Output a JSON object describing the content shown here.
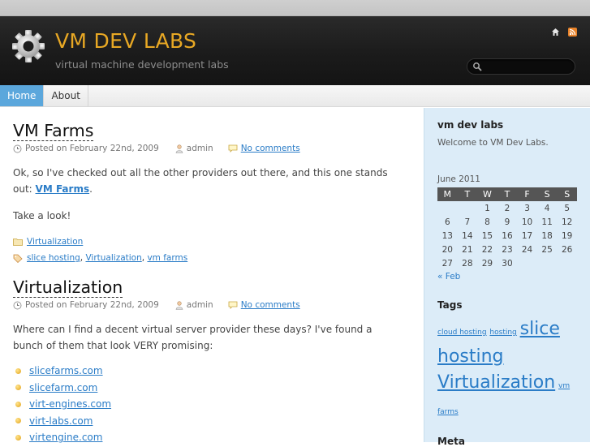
{
  "site": {
    "title": "VM DEV LABS",
    "tagline": "virtual machine development labs",
    "search_placeholder": "",
    "icons": [
      "home-icon",
      "rss-icon"
    ]
  },
  "nav": {
    "items": [
      {
        "label": "Home",
        "active": true
      },
      {
        "label": "About",
        "active": false
      }
    ]
  },
  "posts": [
    {
      "title": "VM Farms",
      "date": "Posted on February 22nd, 2009",
      "author": "admin",
      "comments": "No comments",
      "body_text": "Ok, so I've checked out all the other providers out there, and this one stands out:",
      "body_link": "VM Farms",
      "body_after": ".",
      "body2": "Take a look!",
      "category": "Virtualization",
      "tags": [
        "slice hosting",
        "Virtualization",
        "vm farms"
      ]
    },
    {
      "title": "Virtualization",
      "date": "Posted on February 22nd, 2009",
      "author": "admin",
      "comments": "No comments",
      "body_text": "Where can I find a decent virtual server provider these days? I've found a bunch of them that look VERY promising:",
      "links": [
        "slicefarms.com",
        "slicefarm.com",
        "virt-engines.com",
        "virt-labs.com",
        "virtengine.com"
      ]
    }
  ],
  "sidebar": {
    "about_heading": "vm dev labs",
    "about_text": "Welcome to VM Dev Labs.",
    "calendar": {
      "caption": "June 2011",
      "days": [
        "M",
        "T",
        "W",
        "T",
        "F",
        "S",
        "S"
      ],
      "weeks": [
        [
          "",
          "",
          "1",
          "2",
          "3",
          "4",
          "5"
        ],
        [
          "6",
          "7",
          "8",
          "9",
          "10",
          "11",
          "12"
        ],
        [
          "13",
          "14",
          "15",
          "16",
          "17",
          "18",
          "19"
        ],
        [
          "20",
          "21",
          "22",
          "23",
          "24",
          "25",
          "26"
        ],
        [
          "27",
          "28",
          "29",
          "30",
          "",
          "",
          ""
        ]
      ],
      "prev": "« Feb"
    },
    "tags_heading": "Tags",
    "tags": [
      {
        "label": "cloud hosting",
        "size": "small"
      },
      {
        "label": "hosting",
        "size": "small"
      },
      {
        "label": "slice hosting",
        "size": "large"
      },
      {
        "label": "Virtualization",
        "size": "large"
      },
      {
        "label": "vm farms",
        "size": "small"
      }
    ],
    "meta_heading": "Meta"
  },
  "colors": {
    "title": "#e8a824",
    "accent": "#5ba7dc",
    "link": "#2a7cc7",
    "sidebar_bg": "#dcecf8"
  }
}
